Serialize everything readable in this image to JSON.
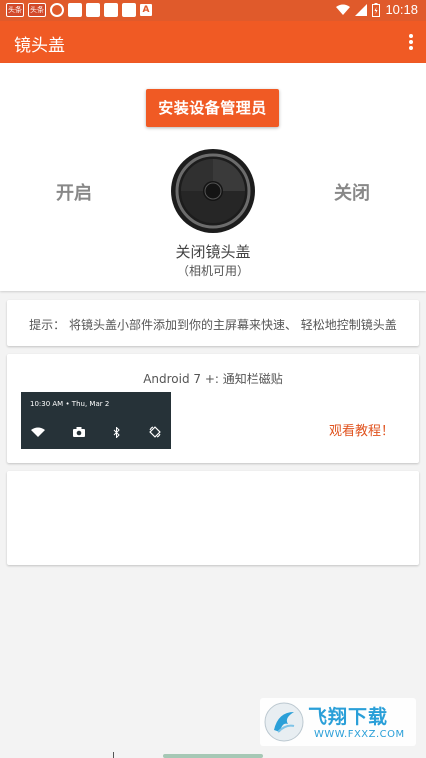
{
  "status_bar": {
    "notif_chip_1": "头条",
    "notif_chip_2": "头条",
    "notif_a": "A",
    "time": "10:18"
  },
  "app_bar": {
    "title": "镜头盖",
    "menu_icon": "more-vert-icon"
  },
  "main": {
    "install_button": "安装设备管理员",
    "toggle_on": "开启",
    "toggle_off": "关闭",
    "lens_icon": "camera-lens-icon",
    "lens_title": "关闭镜头盖",
    "lens_subtitle": "（相机可用）"
  },
  "tip": {
    "text": "提示： 将镜头盖小部件添加到你的主屏幕来快速、 轻松地控制镜头盖"
  },
  "notification": {
    "title": "Android 7 +: 通知栏磁贴",
    "preview_time": "10:30 AM • Thu, Mar 2",
    "tutorial_link": "观看教程！"
  },
  "watermark": {
    "text": "飞翔下载",
    "url": "WWW.FXXZ.COM"
  },
  "colors": {
    "accent": "#f05a24",
    "status_bar": "#e05a2b",
    "link": "#e0531f"
  }
}
